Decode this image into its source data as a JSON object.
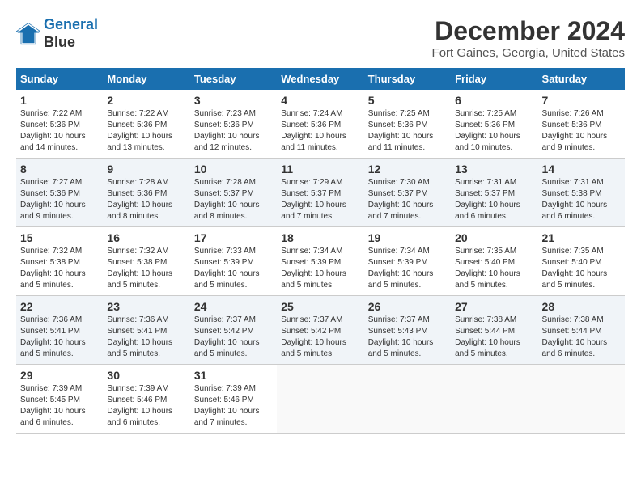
{
  "header": {
    "logo_line1": "General",
    "logo_line2": "Blue",
    "title": "December 2024",
    "subtitle": "Fort Gaines, Georgia, United States"
  },
  "columns": [
    "Sunday",
    "Monday",
    "Tuesday",
    "Wednesday",
    "Thursday",
    "Friday",
    "Saturday"
  ],
  "weeks": [
    [
      {
        "day": "1",
        "info": "Sunrise: 7:22 AM\nSunset: 5:36 PM\nDaylight: 10 hours and 14 minutes."
      },
      {
        "day": "2",
        "info": "Sunrise: 7:22 AM\nSunset: 5:36 PM\nDaylight: 10 hours and 13 minutes."
      },
      {
        "day": "3",
        "info": "Sunrise: 7:23 AM\nSunset: 5:36 PM\nDaylight: 10 hours and 12 minutes."
      },
      {
        "day": "4",
        "info": "Sunrise: 7:24 AM\nSunset: 5:36 PM\nDaylight: 10 hours and 11 minutes."
      },
      {
        "day": "5",
        "info": "Sunrise: 7:25 AM\nSunset: 5:36 PM\nDaylight: 10 hours and 11 minutes."
      },
      {
        "day": "6",
        "info": "Sunrise: 7:25 AM\nSunset: 5:36 PM\nDaylight: 10 hours and 10 minutes."
      },
      {
        "day": "7",
        "info": "Sunrise: 7:26 AM\nSunset: 5:36 PM\nDaylight: 10 hours and 9 minutes."
      }
    ],
    [
      {
        "day": "8",
        "info": "Sunrise: 7:27 AM\nSunset: 5:36 PM\nDaylight: 10 hours and 9 minutes."
      },
      {
        "day": "9",
        "info": "Sunrise: 7:28 AM\nSunset: 5:36 PM\nDaylight: 10 hours and 8 minutes."
      },
      {
        "day": "10",
        "info": "Sunrise: 7:28 AM\nSunset: 5:37 PM\nDaylight: 10 hours and 8 minutes."
      },
      {
        "day": "11",
        "info": "Sunrise: 7:29 AM\nSunset: 5:37 PM\nDaylight: 10 hours and 7 minutes."
      },
      {
        "day": "12",
        "info": "Sunrise: 7:30 AM\nSunset: 5:37 PM\nDaylight: 10 hours and 7 minutes."
      },
      {
        "day": "13",
        "info": "Sunrise: 7:31 AM\nSunset: 5:37 PM\nDaylight: 10 hours and 6 minutes."
      },
      {
        "day": "14",
        "info": "Sunrise: 7:31 AM\nSunset: 5:38 PM\nDaylight: 10 hours and 6 minutes."
      }
    ],
    [
      {
        "day": "15",
        "info": "Sunrise: 7:32 AM\nSunset: 5:38 PM\nDaylight: 10 hours and 5 minutes."
      },
      {
        "day": "16",
        "info": "Sunrise: 7:32 AM\nSunset: 5:38 PM\nDaylight: 10 hours and 5 minutes."
      },
      {
        "day": "17",
        "info": "Sunrise: 7:33 AM\nSunset: 5:39 PM\nDaylight: 10 hours and 5 minutes."
      },
      {
        "day": "18",
        "info": "Sunrise: 7:34 AM\nSunset: 5:39 PM\nDaylight: 10 hours and 5 minutes."
      },
      {
        "day": "19",
        "info": "Sunrise: 7:34 AM\nSunset: 5:39 PM\nDaylight: 10 hours and 5 minutes."
      },
      {
        "day": "20",
        "info": "Sunrise: 7:35 AM\nSunset: 5:40 PM\nDaylight: 10 hours and 5 minutes."
      },
      {
        "day": "21",
        "info": "Sunrise: 7:35 AM\nSunset: 5:40 PM\nDaylight: 10 hours and 5 minutes."
      }
    ],
    [
      {
        "day": "22",
        "info": "Sunrise: 7:36 AM\nSunset: 5:41 PM\nDaylight: 10 hours and 5 minutes."
      },
      {
        "day": "23",
        "info": "Sunrise: 7:36 AM\nSunset: 5:41 PM\nDaylight: 10 hours and 5 minutes."
      },
      {
        "day": "24",
        "info": "Sunrise: 7:37 AM\nSunset: 5:42 PM\nDaylight: 10 hours and 5 minutes."
      },
      {
        "day": "25",
        "info": "Sunrise: 7:37 AM\nSunset: 5:42 PM\nDaylight: 10 hours and 5 minutes."
      },
      {
        "day": "26",
        "info": "Sunrise: 7:37 AM\nSunset: 5:43 PM\nDaylight: 10 hours and 5 minutes."
      },
      {
        "day": "27",
        "info": "Sunrise: 7:38 AM\nSunset: 5:44 PM\nDaylight: 10 hours and 5 minutes."
      },
      {
        "day": "28",
        "info": "Sunrise: 7:38 AM\nSunset: 5:44 PM\nDaylight: 10 hours and 6 minutes."
      }
    ],
    [
      {
        "day": "29",
        "info": "Sunrise: 7:39 AM\nSunset: 5:45 PM\nDaylight: 10 hours and 6 minutes."
      },
      {
        "day": "30",
        "info": "Sunrise: 7:39 AM\nSunset: 5:46 PM\nDaylight: 10 hours and 6 minutes."
      },
      {
        "day": "31",
        "info": "Sunrise: 7:39 AM\nSunset: 5:46 PM\nDaylight: 10 hours and 7 minutes."
      },
      null,
      null,
      null,
      null
    ]
  ]
}
